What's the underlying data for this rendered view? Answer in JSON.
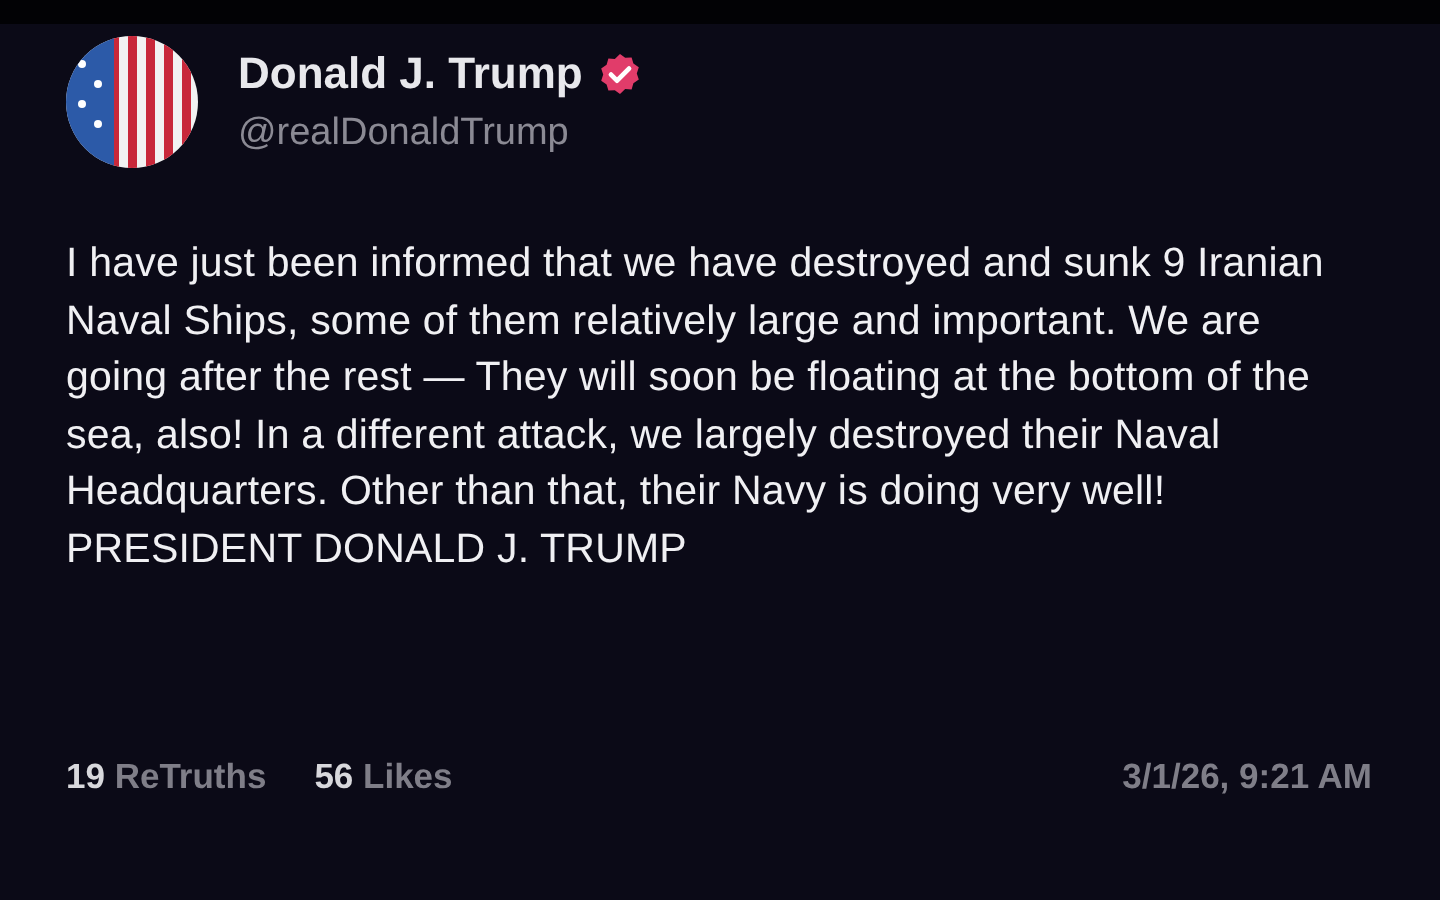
{
  "post": {
    "author": {
      "name": "Donald J. Trump",
      "verified": true,
      "handle": "@realDonaldTrump"
    },
    "text": "I have just been informed that we have destroyed and sunk 9 Iranian Naval Ships, some of them relatively large and important. We are going after the rest — They will soon be floating at the bottom of the sea, also! In a different attack, we largely destroyed their Naval Headquarters. Other than that, their Navy is doing very well! PRESIDENT DONALD J. TRUMP",
    "stats": [
      {
        "count": "19",
        "label": "ReTruths"
      },
      {
        "count": "56",
        "label": "Likes"
      }
    ],
    "timestamp": "3/1/26, 9:21 AM"
  }
}
